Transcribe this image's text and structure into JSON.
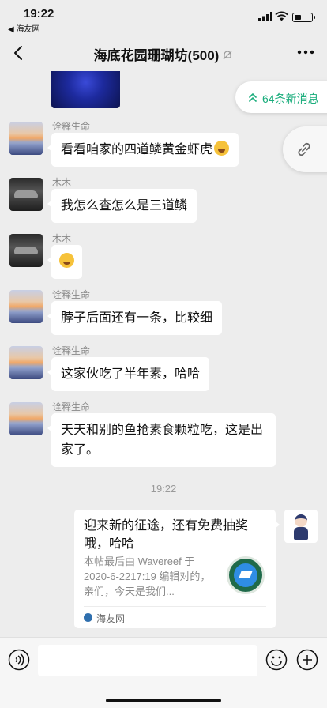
{
  "status": {
    "time": "19:22",
    "back_app": "◀ 海友网"
  },
  "nav": {
    "title": "海底花园珊瑚坊(500)"
  },
  "floating": {
    "new_messages": "64条新消息"
  },
  "messages": [
    {
      "sender": "诠释生命",
      "text": "看看咱家的四道鳞黄金虾虎",
      "emoji": "thinking"
    },
    {
      "sender": "木木",
      "text": "我怎么查怎么是三道鳞"
    },
    {
      "sender": "木木",
      "text": "",
      "emoji": "laugh"
    },
    {
      "sender": "诠释生命",
      "text": "脖子后面还有一条，比较细"
    },
    {
      "sender": "诠释生命",
      "text": "这家伙吃了半年素，哈哈"
    },
    {
      "sender": "诠释生命",
      "text": "天天和别的鱼抢素食颗粒吃，这是出家了。"
    }
  ],
  "timestamp": "19:22",
  "card": {
    "title": "迎来新的征途，还有免费抽奖哦，哈哈",
    "description": "本帖最后由 Wavereef 于 2020-6-2217:19 编辑对的，亲们，今天是我们...",
    "source": "海友网"
  },
  "input": {
    "value": ""
  }
}
